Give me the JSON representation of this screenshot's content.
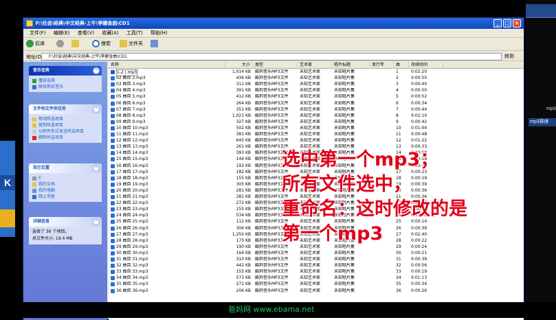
{
  "window": {
    "title": "F:\\社会\\经典\\中文经典-上午\\李娜金曲\\CD1"
  },
  "menu": [
    "文件(F)",
    "编辑(E)",
    "查看(V)",
    "收藏(A)",
    "工具(T)",
    "帮助(H)"
  ],
  "toolbar": {
    "back": "后退",
    "search": "搜索",
    "folders": "文件夹"
  },
  "address": {
    "label": "地址(D)",
    "value": "F:\\社会\\经典\\中文经典-上午\\李娜金曲\\CD1",
    "go": "转到"
  },
  "taskpane": {
    "music_tasks": {
      "title": "音乐任务",
      "items": [
        "播放选择",
        "联机购买音乐"
      ]
    },
    "file_tasks": {
      "title": "文件和文件夹任务",
      "items": [
        "移动所选项目",
        "复制所选项目",
        "以邮件形式发送所选项目",
        "删除所选项目"
      ]
    },
    "other_places": {
      "title": "其它位置",
      "items": [
        "F:",
        "我的文档",
        "我的电脑",
        "网上邻居"
      ]
    },
    "details": {
      "title": "详细信息",
      "line1": "选择了 36 个项目。",
      "line2": "总文件大小: 19.4 MB"
    }
  },
  "columns": [
    "名称",
    "大小",
    "类型",
    "艺术家",
    "唱片标题",
    "发行年",
    "曲",
    "持续时间"
  ],
  "files": [
    {
      "name": "1-2 | mp3",
      "size": "1,014 KB",
      "type": "酷狗音乐MP3文件",
      "artist": "未知艺术家",
      "album": "未知唱片集",
      "track": "1",
      "duration": "0:02:20"
    },
    {
      "name": "02 曲目 2.mp3",
      "size": "436 KB",
      "type": "酷狗音乐MP3文件",
      "artist": "未知艺术家",
      "album": "未知唱片集",
      "track": "2",
      "duration": "0:00:55"
    },
    {
      "name": "03 曲目 3.mp3",
      "size": "311 KB",
      "type": "酷狗音乐MP3文件",
      "artist": "未知艺术家",
      "album": "未知唱片集",
      "track": "3",
      "duration": "0:00:40"
    },
    {
      "name": "04 曲目 4.mp3",
      "size": "391 KB",
      "type": "酷狗音乐MP3文件",
      "artist": "未知艺术家",
      "album": "未知唱片集",
      "track": "4",
      "duration": "0:00:50"
    },
    {
      "name": "05 曲目 5.mp3",
      "size": "412 KB",
      "type": "酷狗音乐MP3文件",
      "artist": "未知艺术家",
      "album": "未知唱片集",
      "track": "5",
      "duration": "0:00:52"
    },
    {
      "name": "06 曲目 6.mp3",
      "size": "264 KB",
      "type": "酷狗音乐MP3文件",
      "artist": "未知艺术家",
      "album": "未知唱片集",
      "track": "6",
      "duration": "0:00:34"
    },
    {
      "name": "07 曲目 7.mp3",
      "size": "351 KB",
      "type": "酷狗音乐MP3文件",
      "artist": "未知艺术家",
      "album": "未知唱片集",
      "track": "7",
      "duration": "0:00:44"
    },
    {
      "name": "08 曲目 8.mp3",
      "size": "1,021 KB",
      "type": "酷狗音乐MP3文件",
      "artist": "未知艺术家",
      "album": "未知唱片集",
      "track": "8",
      "duration": "0:02:10"
    },
    {
      "name": "09 曲目 9.mp3",
      "size": "327 KB",
      "type": "酷狗音乐MP3文件",
      "artist": "未知艺术家",
      "album": "未知唱片集",
      "track": "9",
      "duration": "0:00:42"
    },
    {
      "name": "10 曲目 10.mp3",
      "size": "502 KB",
      "type": "酷狗音乐MP3文件",
      "artist": "未知艺术家",
      "album": "未知唱片集",
      "track": "10",
      "duration": "0:01:04"
    },
    {
      "name": "11 曲目 11.mp3",
      "size": "381 KB",
      "type": "酷狗音乐MP3文件",
      "artist": "未知艺术家",
      "album": "未知唱片集",
      "track": "11",
      "duration": "0:00:48"
    },
    {
      "name": "12 曲目 12.mp3",
      "size": "645 KB",
      "type": "酷狗音乐MP3文件",
      "artist": "未知艺术家",
      "album": "未知唱片集",
      "track": "12",
      "duration": "0:01:22"
    },
    {
      "name": "13 曲目 13.mp3",
      "size": "261 KB",
      "type": "酷狗音乐MP3文件",
      "artist": "未知艺术家",
      "album": "未知唱片集",
      "track": "13",
      "duration": "0:00:33"
    },
    {
      "name": "14 曲目 14.mp3",
      "size": "393 KB",
      "type": "酷狗音乐MP3文件",
      "artist": "未知艺术家",
      "album": "未知唱片集",
      "track": "14",
      "duration": "0:00:50"
    },
    {
      "name": "15 曲目 15.mp3",
      "size": "144 KB",
      "type": "酷狗音乐MP3文件",
      "artist": "未知艺术家",
      "album": "未知唱片集",
      "track": "15",
      "duration": "0:00:18"
    },
    {
      "name": "16 曲目 16.mp3",
      "size": "192 KB",
      "type": "酷狗音乐MP3文件",
      "artist": "未知艺术家",
      "album": "未知唱片集",
      "track": "16",
      "duration": "0:00:24"
    },
    {
      "name": "17 曲目 17.mp3",
      "size": "182 KB",
      "type": "酷狗音乐MP3文件",
      "artist": "未知艺术家",
      "album": "未知唱片集",
      "track": "17",
      "duration": "0:00:23"
    },
    {
      "name": "18 曲目 18.mp3",
      "size": "155 KB",
      "type": "酷狗音乐MP3文件",
      "artist": "未知艺术家",
      "album": "未知唱片集",
      "track": "18",
      "duration": "0:00:19"
    },
    {
      "name": "19 曲目 19.mp3",
      "size": "305 KB",
      "type": "酷狗音乐MP3文件",
      "artist": "未知艺术家",
      "album": "未知唱片集",
      "track": "19",
      "duration": "0:00:39"
    },
    {
      "name": "20 曲目 20.mp3",
      "size": "281 KB",
      "type": "酷狗音乐MP3文件",
      "artist": "未知艺术家",
      "album": "未知唱片集",
      "track": "20",
      "duration": "0:00:36"
    },
    {
      "name": "21 曲目 21.mp3",
      "size": "281 KB",
      "type": "酷狗音乐MP3文件",
      "artist": "未知艺术家",
      "album": "未知唱片集",
      "track": "21",
      "duration": "0:00:36"
    },
    {
      "name": "22 曲目 22.mp3",
      "size": "272 KB",
      "type": "酷狗音乐MP3文件",
      "artist": "未知艺术家",
      "album": "未知唱片集",
      "track": "22",
      "duration": "0:00:34"
    },
    {
      "name": "23 曲目 23.mp3",
      "size": "155 KB",
      "type": "酷狗音乐MP3文件",
      "artist": "未知艺术家",
      "album": "未知唱片集",
      "track": "23",
      "duration": "0:00:19"
    },
    {
      "name": "24 曲目 24.mp3",
      "size": "534 KB",
      "type": "酷狗音乐MP3文件",
      "artist": "未知艺术家",
      "album": "未知唱片集",
      "track": "24",
      "duration": "0:01:08"
    },
    {
      "name": "25 曲目 25.mp3",
      "size": "112 KB",
      "type": "酷狗音乐MP3文件",
      "artist": "未知艺术家",
      "album": "未知唱片集",
      "track": "25",
      "duration": "0:00:14"
    },
    {
      "name": "26 曲目 26.mp3",
      "size": "306 KB",
      "type": "酷狗音乐MP3文件",
      "artist": "未知艺术家",
      "album": "未知唱片集",
      "track": "26",
      "duration": "0:00:39"
    },
    {
      "name": "27 曲目 27.mp3",
      "size": "1,250 KB",
      "type": "酷狗音乐MP3文件",
      "artist": "未知艺术家",
      "album": "未知唱片集",
      "track": "27",
      "duration": "0:02:40"
    },
    {
      "name": "28 曲目 28.mp3",
      "size": "175 KB",
      "type": "酷狗音乐MP3文件",
      "artist": "未知艺术家",
      "album": "未知唱片集",
      "track": "28",
      "duration": "0:00:22"
    },
    {
      "name": "29 曲目 29.mp3",
      "size": "190 KB",
      "type": "酷狗音乐MP3文件",
      "artist": "未知艺术家",
      "album": "未知唱片集",
      "track": "29",
      "duration": "0:00:24"
    },
    {
      "name": "30 曲目 30.mp3",
      "size": "164 KB",
      "type": "酷狗音乐MP3文件",
      "artist": "未知艺术家",
      "album": "未知唱片集",
      "track": "30",
      "duration": "0:00:21"
    },
    {
      "name": "31 曲目 31.mp3",
      "size": "310 KB",
      "type": "酷狗音乐MP3文件",
      "artist": "未知艺术家",
      "album": "未知唱片集",
      "track": "31",
      "duration": "0:00:39"
    },
    {
      "name": "32 曲目 32.mp3",
      "size": "442 KB",
      "type": "酷狗音乐MP3文件",
      "artist": "未知艺术家",
      "album": "未知唱片集",
      "track": "32",
      "duration": "0:00:56"
    },
    {
      "name": "33 曲目 33.mp3",
      "size": "155 KB",
      "type": "酷狗音乐MP3文件",
      "artist": "未知艺术家",
      "album": "未知唱片集",
      "track": "33",
      "duration": "0:00:19"
    },
    {
      "name": "34 曲目 34.mp3",
      "size": "573 KB",
      "type": "酷狗音乐MP3文件",
      "artist": "未知艺术家",
      "album": "未知唱片集",
      "track": "34",
      "duration": "0:01:13"
    },
    {
      "name": "35 曲目 35.mp3",
      "size": "271 KB",
      "type": "酷狗音乐MP3文件",
      "artist": "未知艺术家",
      "album": "未知唱片集",
      "track": "35",
      "duration": "0:00:34"
    },
    {
      "name": "36 曲目 36.mp3",
      "size": "206 KB",
      "type": "酷狗音乐MP3文件",
      "artist": "未知艺术家",
      "album": "未知唱片集",
      "track": "36",
      "duration": "0:00:26"
    }
  ],
  "overlay": {
    "line1": "选中第一个mp3；",
    "line2": "所有文件选中，",
    "line3": "重命名：这时修改的是",
    "line4": "第一个mp3"
  },
  "side_right": {
    "text1": "mp3",
    "text2": "mp3排序"
  },
  "side_left": {
    "badge": "K"
  },
  "watermark": "爸妈网 www.ebama.net",
  "colors": {
    "xp_title": "#0d47c0",
    "task_pane": "#6375d6",
    "overlay_text": "#e0001a",
    "watermark": "#22c35a"
  }
}
